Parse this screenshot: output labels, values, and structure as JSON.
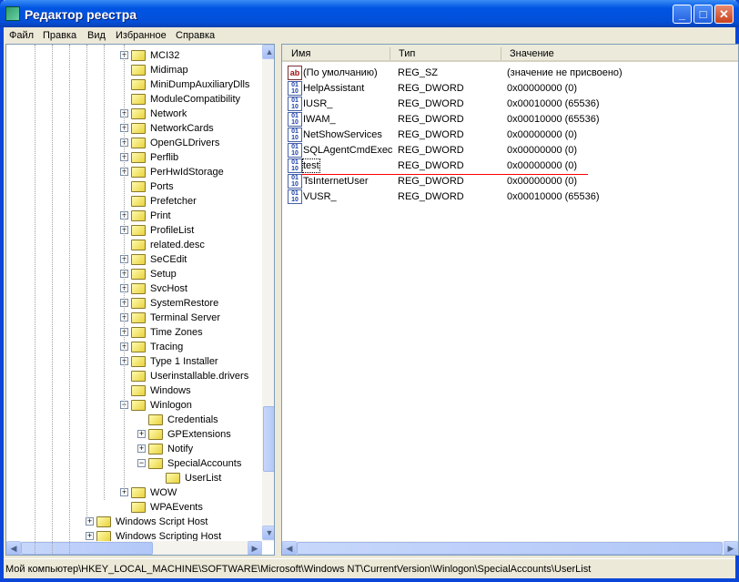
{
  "window": {
    "title": "Редактор реестра",
    "min": "_",
    "max": "□",
    "close": "✕"
  },
  "menu": [
    "Файл",
    "Правка",
    "Вид",
    "Избранное",
    "Справка"
  ],
  "tree": [
    {
      "label": "MCI32",
      "level": 1,
      "exp": "+"
    },
    {
      "label": "Midimap",
      "level": 1,
      "exp": ""
    },
    {
      "label": "MiniDumpAuxiliaryDlls",
      "level": 1,
      "exp": ""
    },
    {
      "label": "ModuleCompatibility",
      "level": 1,
      "exp": ""
    },
    {
      "label": "Network",
      "level": 1,
      "exp": "+"
    },
    {
      "label": "NetworkCards",
      "level": 1,
      "exp": "+"
    },
    {
      "label": "OpenGLDrivers",
      "level": 1,
      "exp": "+"
    },
    {
      "label": "Perflib",
      "level": 1,
      "exp": "+"
    },
    {
      "label": "PerHwIdStorage",
      "level": 1,
      "exp": "+"
    },
    {
      "label": "Ports",
      "level": 1,
      "exp": ""
    },
    {
      "label": "Prefetcher",
      "level": 1,
      "exp": ""
    },
    {
      "label": "Print",
      "level": 1,
      "exp": "+"
    },
    {
      "label": "ProfileList",
      "level": 1,
      "exp": "+"
    },
    {
      "label": "related.desc",
      "level": 1,
      "exp": ""
    },
    {
      "label": "SeCEdit",
      "level": 1,
      "exp": "+"
    },
    {
      "label": "Setup",
      "level": 1,
      "exp": "+"
    },
    {
      "label": "SvcHost",
      "level": 1,
      "exp": "+"
    },
    {
      "label": "SystemRestore",
      "level": 1,
      "exp": "+"
    },
    {
      "label": "Terminal Server",
      "level": 1,
      "exp": "+"
    },
    {
      "label": "Time Zones",
      "level": 1,
      "exp": "+"
    },
    {
      "label": "Tracing",
      "level": 1,
      "exp": "+"
    },
    {
      "label": "Type 1 Installer",
      "level": 1,
      "exp": "+"
    },
    {
      "label": "Userinstallable.drivers",
      "level": 1,
      "exp": ""
    },
    {
      "label": "Windows",
      "level": 1,
      "exp": ""
    },
    {
      "label": "Winlogon",
      "level": 1,
      "exp": "−"
    },
    {
      "label": "Credentials",
      "level": 2,
      "exp": ""
    },
    {
      "label": "GPExtensions",
      "level": 2,
      "exp": "+"
    },
    {
      "label": "Notify",
      "level": 2,
      "exp": "+"
    },
    {
      "label": "SpecialAccounts",
      "level": 2,
      "exp": "−"
    },
    {
      "label": "UserList",
      "level": 3,
      "exp": "",
      "selected": true
    },
    {
      "label": "WOW",
      "level": 1,
      "exp": "+"
    },
    {
      "label": "WPAEvents",
      "level": 1,
      "exp": ""
    },
    {
      "label": "Windows Script Host",
      "level": 0,
      "exp": "+"
    },
    {
      "label": "Windows Scripting Host",
      "level": 0,
      "exp": "+"
    }
  ],
  "list": {
    "columns": [
      "Имя",
      "Тип",
      "Значение"
    ],
    "rows": [
      {
        "icon": "ab",
        "name": "(По умолчанию)",
        "type": "REG_SZ",
        "value": "(значение не присвоено)"
      },
      {
        "icon": "dword",
        "name": "HelpAssistant",
        "type": "REG_DWORD",
        "value": "0x00000000 (0)"
      },
      {
        "icon": "dword",
        "name": "IUSR_",
        "type": "REG_DWORD",
        "value": "0x00010000 (65536)"
      },
      {
        "icon": "dword",
        "name": "IWAM_",
        "type": "REG_DWORD",
        "value": "0x00010000 (65536)"
      },
      {
        "icon": "dword",
        "name": "NetShowServices",
        "type": "REG_DWORD",
        "value": "0x00000000 (0)"
      },
      {
        "icon": "dword",
        "name": "SQLAgentCmdExec",
        "type": "REG_DWORD",
        "value": "0x00000000 (0)"
      },
      {
        "icon": "dword",
        "name": "test",
        "type": "REG_DWORD",
        "value": "0x00000000 (0)",
        "focused": true
      },
      {
        "icon": "dword",
        "name": "TsInternetUser",
        "type": "REG_DWORD",
        "value": "0x00000000 (0)"
      },
      {
        "icon": "dword",
        "name": "VUSR_",
        "type": "REG_DWORD",
        "value": "0x00010000 (65536)"
      }
    ]
  },
  "annotation_color": "#ff0000",
  "status": "Мой компьютер\\HKEY_LOCAL_MACHINE\\SOFTWARE\\Microsoft\\Windows NT\\CurrentVersion\\Winlogon\\SpecialAccounts\\UserList"
}
